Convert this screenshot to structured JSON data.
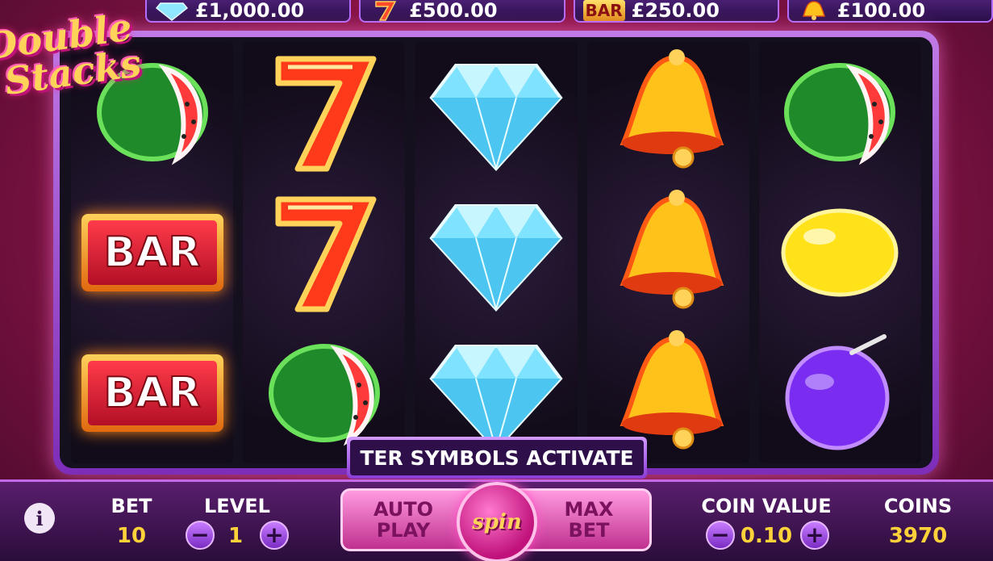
{
  "game": {
    "logo_line1": "Double",
    "logo_line2": "Stacks"
  },
  "paytable": [
    {
      "icon": "diamond-icon",
      "amount": "£1,000.00"
    },
    {
      "icon": "seven-icon",
      "amount": "£500.00"
    },
    {
      "icon": "bar-icon",
      "icon_text": "BAR",
      "amount": "£250.00"
    },
    {
      "icon": "bell-icon",
      "amount": "£100.00"
    }
  ],
  "reels": [
    [
      "watermelon",
      "bar",
      "bar"
    ],
    [
      "seven",
      "seven",
      "watermelon"
    ],
    [
      "diamond",
      "diamond",
      "diamond"
    ],
    [
      "bell",
      "bell",
      "bell"
    ],
    [
      "watermelon",
      "lemon",
      "plum"
    ]
  ],
  "symbol_text": {
    "bar": "BAR"
  },
  "banner": {
    "message": "TER SYMBOLS ACTIVATE"
  },
  "controls": {
    "info_label": "i",
    "bet_label": "BET",
    "bet_value": "10",
    "level_label": "LEVEL",
    "level_value": "1",
    "minus": "−",
    "plus": "+",
    "autoplay_line1": "AUTO",
    "autoplay_line2": "PLAY",
    "spin_label": "spin",
    "maxbet_line1": "MAX",
    "maxbet_line2": "BET",
    "coin_value_label": "COIN VALUE",
    "coin_value": "0.10",
    "coins_label": "COINS",
    "coins_value": "3970"
  },
  "colors": {
    "accent": "#c46ae8",
    "value_yellow": "#ffd23a",
    "background": "#8c1447"
  }
}
